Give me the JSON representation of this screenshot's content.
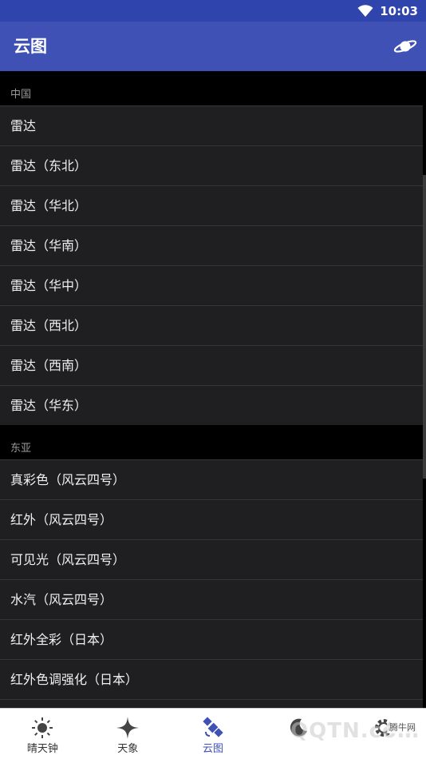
{
  "status": {
    "time": "10:03"
  },
  "app_bar": {
    "title": "云图"
  },
  "sections": [
    {
      "header": "中国",
      "items": [
        "雷达",
        "雷达（东北）",
        "雷达（华北）",
        "雷达（华南）",
        "雷达（华中）",
        "雷达（西北）",
        "雷达（西南）",
        "雷达（华东）"
      ]
    },
    {
      "header": "东亚",
      "items": [
        "真彩色（风云四号）",
        "红外（风云四号）",
        "可见光（风云四号）",
        "水汽（风云四号）",
        "红外全彩（日本）",
        "红外色调强化（日本）"
      ]
    }
  ],
  "bottom_nav": {
    "items": [
      {
        "label": "晴天钟",
        "icon": "sun-icon"
      },
      {
        "label": "天象",
        "icon": "star-icon"
      },
      {
        "label": "云图",
        "icon": "satellite-icon",
        "active": true
      },
      {
        "label": "",
        "icon": "moon-icon"
      },
      {
        "label": "",
        "icon": "gear-icon"
      }
    ]
  },
  "watermark": {
    "text": "QQTN.com",
    "tag": "腾牛网"
  },
  "colors": {
    "app_bar": "#3f51b5",
    "status_bar": "#2f45ad",
    "row_bg": "#1f1f21",
    "active": "#3f51b5"
  }
}
